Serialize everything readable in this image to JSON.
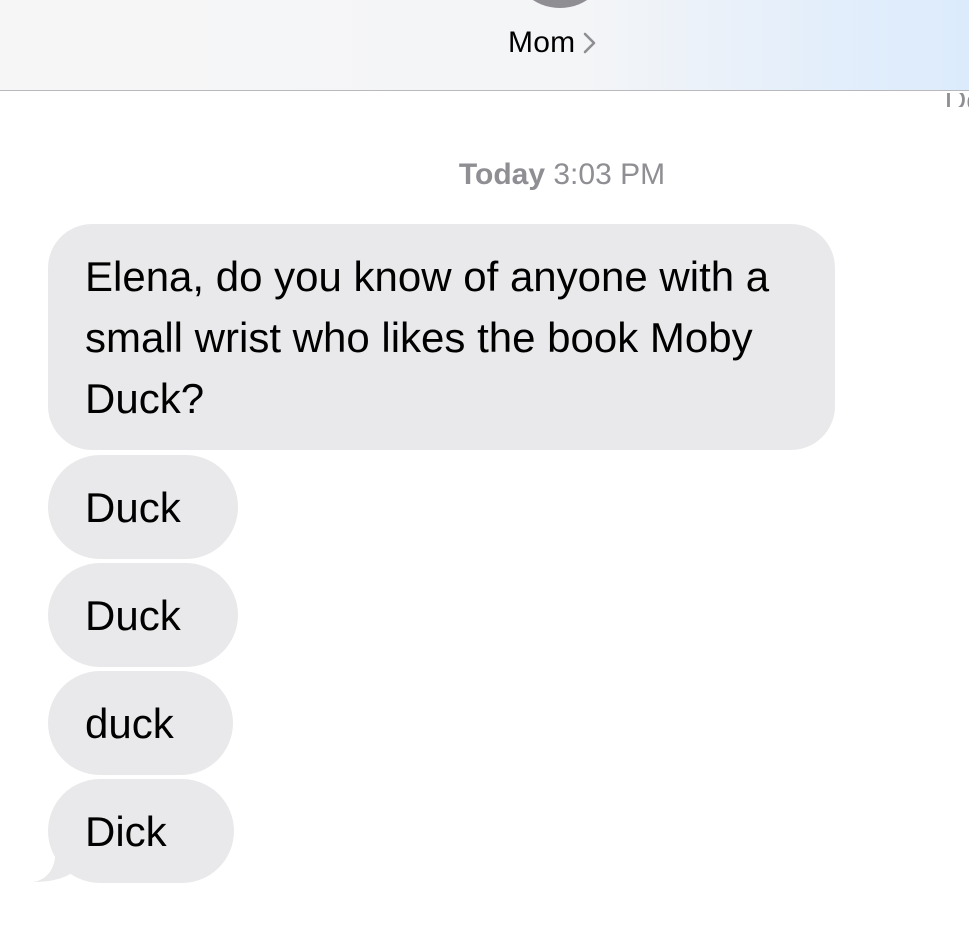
{
  "header": {
    "contact_name": "Mom",
    "contact_chevron": "chevron-right-icon",
    "corner_partial_text": "De"
  },
  "thread": {
    "timestamp_day": "Today",
    "timestamp_time": "3:03 PM",
    "messages": [
      {
        "direction": "incoming",
        "text": "Elena, do you know of anyone with a small wrist who likes the book Moby Duck?"
      },
      {
        "direction": "incoming",
        "text": "Duck"
      },
      {
        "direction": "incoming",
        "text": "Duck"
      },
      {
        "direction": "incoming",
        "text": "duck"
      },
      {
        "direction": "incoming",
        "text": "Dick"
      }
    ]
  },
  "colors": {
    "incoming_bubble": "#e9e9eb",
    "secondary_text": "#8e8e93",
    "header_background": "#f6f6f7",
    "header_tint": "#dcebfc"
  }
}
